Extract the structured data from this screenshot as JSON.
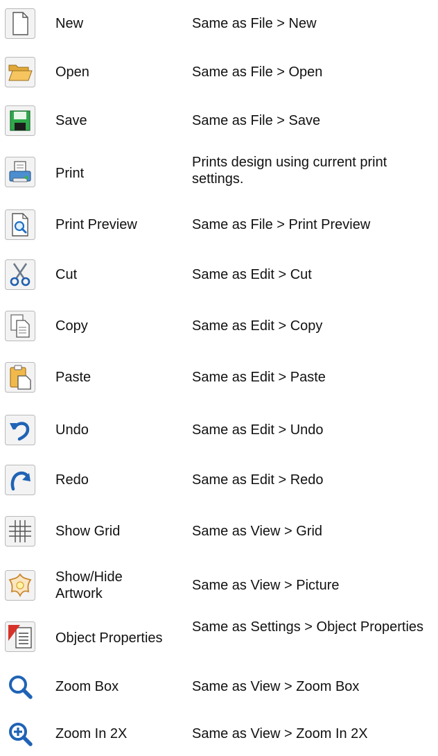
{
  "rows": [
    {
      "icon": "new-document-icon",
      "name": "New",
      "desc": "Same as File > New"
    },
    {
      "icon": "open-folder-icon",
      "name": "Open",
      "desc": "Same as File > Open"
    },
    {
      "icon": "save-disk-icon",
      "name": "Save",
      "desc": "Same as File > Save"
    },
    {
      "icon": "printer-icon",
      "name": "Print",
      "desc": "Prints design using current print settings."
    },
    {
      "icon": "print-preview-icon",
      "name": "Print Preview",
      "desc": "Same as File > Print Preview"
    },
    {
      "icon": "scissors-icon",
      "name": "Cut",
      "desc": "Same as Edit > Cut"
    },
    {
      "icon": "copy-icon",
      "name": "Copy",
      "desc": "Same as Edit > Copy"
    },
    {
      "icon": "paste-icon",
      "name": "Paste",
      "desc": "Same as Edit > Paste"
    },
    {
      "icon": "undo-arrow-icon",
      "name": "Undo",
      "desc": "Same as Edit > Undo"
    },
    {
      "icon": "redo-arrow-icon",
      "name": "Redo",
      "desc": "Same as Edit > Redo"
    },
    {
      "icon": "grid-icon",
      "name": "Show Grid",
      "desc": "Same as View > Grid"
    },
    {
      "icon": "flower-artwork-icon",
      "name": "Show/Hide Artwork",
      "desc": "Same as View > Picture"
    },
    {
      "icon": "object-properties-icon",
      "name": "Object Properties",
      "desc": "Same as Settings > Object Properties"
    },
    {
      "icon": "zoom-box-icon",
      "name": "Zoom Box",
      "desc": "Same as View > Zoom Box"
    },
    {
      "icon": "zoom-in-icon",
      "name": "Zoom In 2X",
      "desc": "Same as View > Zoom In 2X"
    }
  ]
}
